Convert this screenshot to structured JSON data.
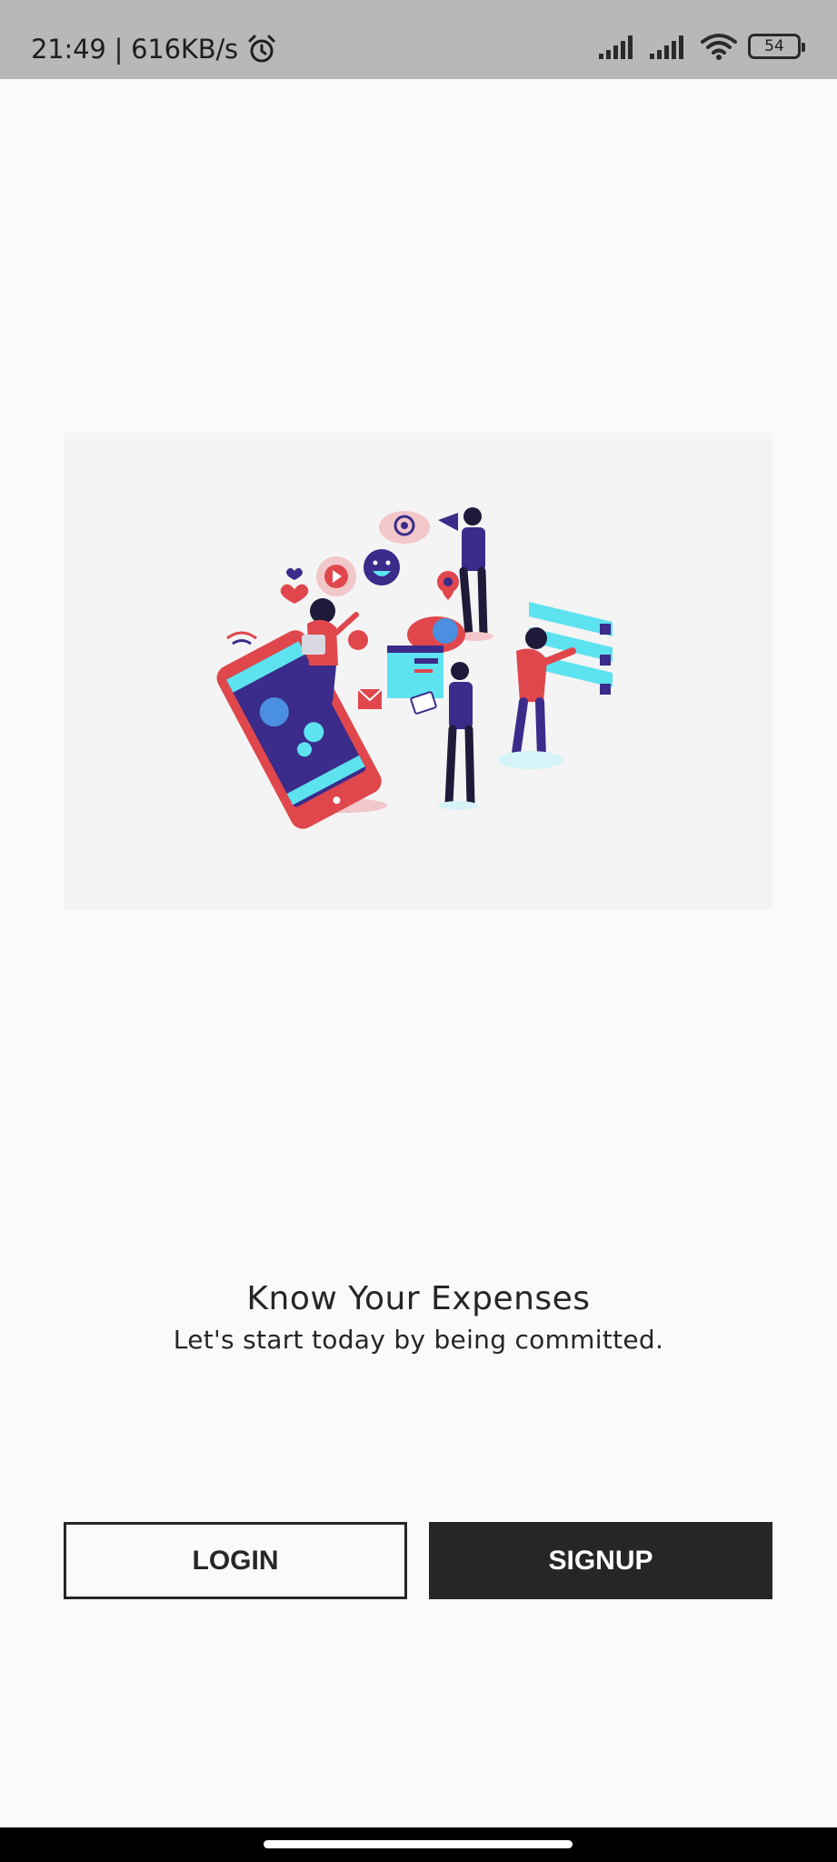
{
  "status_bar": {
    "time_speed": "21:49 | 616KB/s",
    "battery_level": "54",
    "icons": [
      "alarm-icon",
      "signal-icon",
      "signal-icon",
      "wifi-icon",
      "battery-icon"
    ]
  },
  "hero": {
    "illustration": "social-media-illustration"
  },
  "tagline": {
    "title": "Know Your Expenses",
    "subtitle": "Let's start today by being committed."
  },
  "actions": {
    "login_label": "LOGIN",
    "signup_label": "SIGNUP"
  },
  "colors": {
    "background": "#fafafa",
    "status_bar": "#b8b8b8",
    "dark": "#262626",
    "accent_red": "#e0474c",
    "accent_purple": "#3b2b8a",
    "accent_cyan": "#5de2ef"
  }
}
